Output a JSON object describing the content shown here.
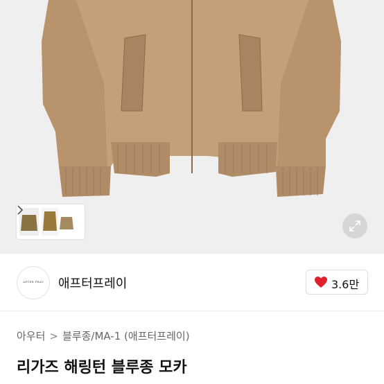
{
  "store": {
    "logo_text": "AFTER PRAY",
    "name": "애프터프레이",
    "likes": "3.6만"
  },
  "breadcrumb": {
    "items": [
      "아우터",
      "블루종/MA-1 (애프터프레이)"
    ],
    "separator": ">"
  },
  "product": {
    "title": "리가즈 해링턴 블루종 모카"
  },
  "colors": {
    "jacket": "#c4a078",
    "like_heart": "#e0202e"
  }
}
